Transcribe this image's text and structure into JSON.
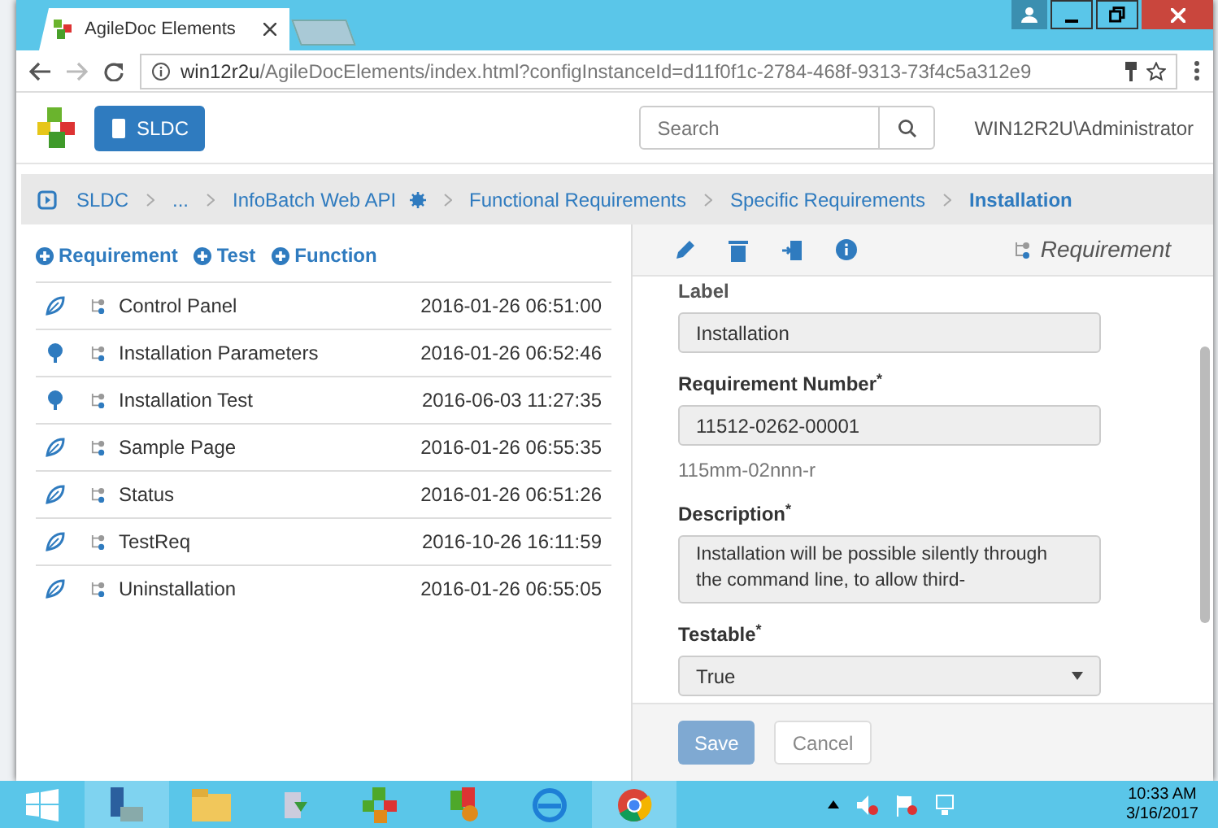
{
  "browser": {
    "tab_title": "AgileDoc Elements",
    "url_host": "win12r2u",
    "url_path": "/AgileDocElements/index.html?configInstanceId=d11f0f1c-2784-468f-9313-73f4c5a312e9"
  },
  "navbar": {
    "project_button": "SLDC",
    "search": {
      "placeholder": "Search"
    },
    "user": "WIN12R2U\\Administrator"
  },
  "breadcrumb": [
    {
      "label": "SLDC",
      "current": false
    },
    {
      "label": "...",
      "current": false
    },
    {
      "label": "InfoBatch Web API",
      "current": false
    },
    {
      "label": "Functional Requirements",
      "current": false
    },
    {
      "label": "Specific Requirements",
      "current": false
    },
    {
      "label": "Installation",
      "current": true
    }
  ],
  "add_links": [
    "Requirement",
    "Test",
    "Function"
  ],
  "items": [
    {
      "kind": "leaf",
      "name": "Control Panel",
      "date": "2016-01-26 06:51:00"
    },
    {
      "kind": "node",
      "name": "Installation Parameters",
      "date": "2016-01-26 06:52:46"
    },
    {
      "kind": "node",
      "name": "Installation Test",
      "date": "2016-06-03 11:27:35"
    },
    {
      "kind": "leaf",
      "name": "Sample Page",
      "date": "2016-01-26 06:55:35"
    },
    {
      "kind": "leaf",
      "name": "Status",
      "date": "2016-01-26 06:51:26"
    },
    {
      "kind": "leaf",
      "name": "TestReq",
      "date": "2016-10-26 16:11:59"
    },
    {
      "kind": "leaf",
      "name": "Uninstallation",
      "date": "2016-01-26 06:55:05"
    }
  ],
  "detail": {
    "type_label": "Requirement",
    "fields": [
      {
        "kind": "input",
        "label": "Label",
        "required": false,
        "value": "Installation"
      },
      {
        "kind": "input",
        "label": "Requirement Number$^{*}$",
        "required": true,
        "value": "11512-0262-00001",
        "help": "115mm-02nnn-r"
      },
      {
        "kind": "textarea",
        "label": "Description$^{*}$",
        "required": true,
        "value": "Installation will be possible silently through the command line, to allow third-"
      },
      {
        "kind": "select",
        "label": "Testable$^{*}$",
        "required": true,
        "value": "True"
      }
    ],
    "buttons": [
      {
        "label": "Save",
        "kind": "primary",
        "disabled": true
      },
      {
        "label": "Cancel",
        "kind": "secondary",
        "disabled": false
      }
    ]
  },
  "taskbar": {
    "time": "10:33 AM",
    "date": "3/16/2017"
  }
}
